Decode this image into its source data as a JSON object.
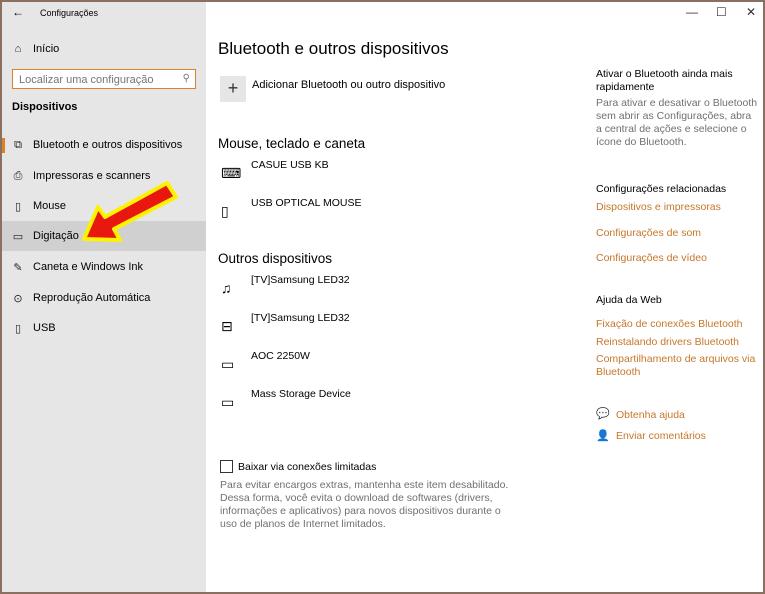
{
  "window": {
    "title": "Configurações",
    "back_icon": "arrow-left-icon",
    "controls": [
      "minimize",
      "maximize",
      "close"
    ]
  },
  "sidebar": {
    "home": "Início",
    "search_placeholder": "Localizar uma configuração",
    "section": "Dispositivos",
    "items": [
      {
        "label": "Bluetooth e outros dispositivos",
        "icon": "bluetooth-devices-icon",
        "active": true
      },
      {
        "label": "Impressoras e scanners",
        "icon": "printer-icon"
      },
      {
        "label": "Mouse",
        "icon": "mouse-icon"
      },
      {
        "label": "Digitação",
        "icon": "keyboard-icon",
        "hovered": true
      },
      {
        "label": "Caneta e Windows Ink",
        "icon": "pen-icon"
      },
      {
        "label": "Reprodução Automática",
        "icon": "autoplay-icon"
      },
      {
        "label": "USB",
        "icon": "usb-icon"
      }
    ]
  },
  "main": {
    "title": "Bluetooth e outros dispositivos",
    "add_label": "Adicionar Bluetooth ou outro dispositivo",
    "section1": "Mouse, teclado e caneta",
    "devices1": [
      {
        "name": "CASUE USB KB",
        "icon": "keyboard-icon"
      },
      {
        "name": "USB OPTICAL MOUSE",
        "icon": "mouse-icon"
      }
    ],
    "section2": "Outros dispositivos",
    "devices2": [
      {
        "name": "[TV]Samsung LED32",
        "icon": "media-device-icon"
      },
      {
        "name": "[TV]Samsung LED32",
        "icon": "tv-device-icon"
      },
      {
        "name": "AOC 2250W",
        "icon": "monitor-icon"
      },
      {
        "name": "Mass Storage Device",
        "icon": "drive-icon"
      }
    ],
    "metered_label": "Baixar via conexões limitadas",
    "metered_checked": false,
    "metered_desc": "Para evitar encargos extras, mantenha este item desabilitado. Dessa forma, você evita o download de softwares (drivers, informações e aplicativos) para novos dispositivos durante o uso de planos de Internet limitados."
  },
  "right": {
    "tip_title": "Ativar o Bluetooth ainda mais rapidamente",
    "tip_desc": "Para ativar e desativar o Bluetooth sem abrir as Configurações, abra a central de ações e selecione o ícone do Bluetooth.",
    "related_title": "Configurações relacionadas",
    "related": [
      "Dispositivos e impressoras",
      "Configurações de som",
      "Configurações de vídeo"
    ],
    "help_title": "Ajuda da Web",
    "help": [
      "Fixação de conexões Bluetooth",
      "Reinstalando drivers Bluetooth",
      "Compartilhamento de arquivos via Bluetooth"
    ],
    "get_help": "Obtenha ajuda",
    "feedback": "Enviar comentários"
  },
  "colors": {
    "accent": "#d9822b",
    "link": "#c6772a",
    "sidebar": "#e6e6e6",
    "arrow": "#e8170f",
    "arrow_outline": "#fff200"
  }
}
